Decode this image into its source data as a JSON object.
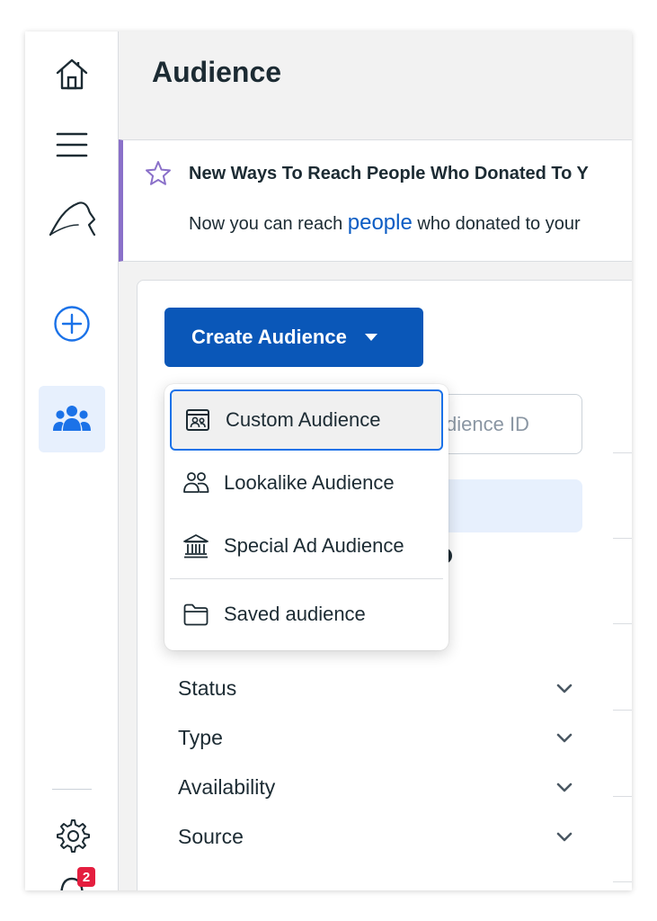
{
  "page": {
    "title": "Audience"
  },
  "rail": {
    "icons": [
      "home-icon",
      "menu-icon",
      "brand-logo-icon",
      "add-icon",
      "audiences-icon",
      "settings-icon",
      "notifications-icon"
    ],
    "notification_count": "2",
    "active_color": "#e7f0fd",
    "accent": "#1b72e8"
  },
  "banner": {
    "title": "New Ways To Reach People Who Donated To Y",
    "text_before": "Now you can reach ",
    "link": "people",
    "text_after": " who donated to your",
    "accent": "#8a70c9"
  },
  "toolbar": {
    "create_label": "Create Audience",
    "search_placeholder": "dience ID",
    "button_color": "#0a57b8"
  },
  "dropdown": {
    "items": [
      {
        "label": "Custom Audience",
        "icon": "custom-audience-icon",
        "selected": true
      },
      {
        "label": "Lookalike Audience",
        "icon": "lookalike-icon",
        "selected": false
      },
      {
        "label": "Special Ad Audience",
        "icon": "bank-icon",
        "selected": false
      },
      {
        "label": "Saved audience",
        "icon": "folder-icon",
        "selected": false
      }
    ]
  },
  "filters": [
    {
      "label": "Status"
    },
    {
      "label": "Type"
    },
    {
      "label": "Availability"
    },
    {
      "label": "Source"
    }
  ]
}
